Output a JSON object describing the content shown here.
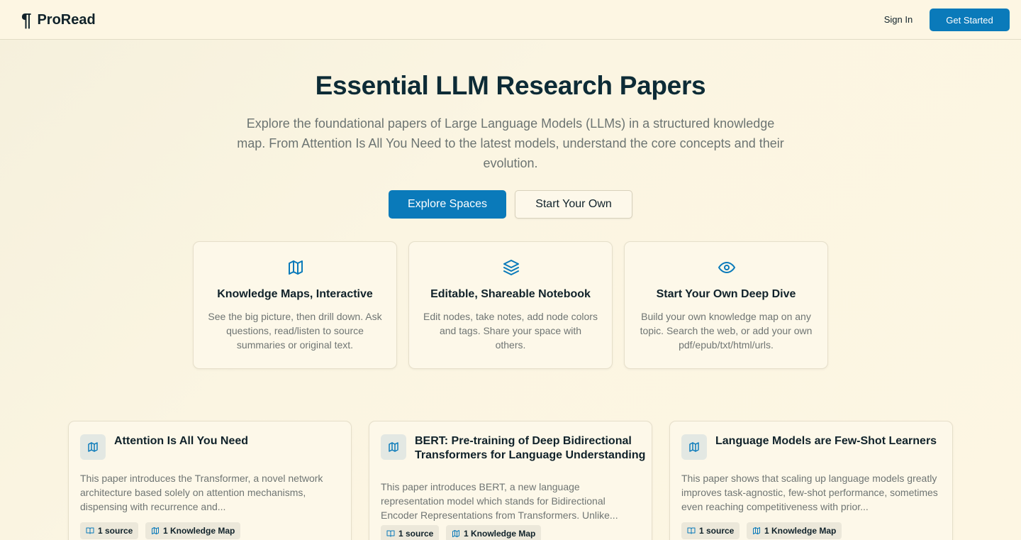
{
  "header": {
    "brand_mark": "¶",
    "brand_name": "ProRead",
    "signin_label": "Sign In",
    "getstarted_label": "Get Started"
  },
  "hero": {
    "title": "Essential LLM Research Papers",
    "subtitle": "Explore the foundational papers of Large Language Models (LLMs) in a structured knowledge map. From Attention Is All You Need to the latest models, understand the core concepts and their evolution.",
    "primary_label": "Explore Spaces",
    "secondary_label": "Start Your Own"
  },
  "features": [
    {
      "icon": "map-icon",
      "title": "Knowledge Maps, Interactive",
      "desc": "See the big picture, then drill down. Ask questions, read/listen to source summaries or original text."
    },
    {
      "icon": "layers-icon",
      "title": "Editable, Shareable Notebook",
      "desc": "Edit nodes, take notes, add node colors and tags. Share your space with others."
    },
    {
      "icon": "eye-icon",
      "title": "Start Your Own Deep Dive",
      "desc": "Build your own knowledge map on any topic. Search the web, or add your own pdf/epub/txt/html/urls."
    }
  ],
  "papers": [
    {
      "title": "Attention Is All You Need",
      "desc": "This paper introduces the Transformer, a novel network architecture based solely on attention mechanisms, dispensing with recurrence and...",
      "sources": "1 source",
      "maps": "1 Knowledge Map"
    },
    {
      "title": "BERT: Pre-training of Deep Bidirectional Transformers for Language Understanding",
      "desc": "This paper introduces BERT, a new language representation model which stands for Bidirectional Encoder Representations from Transformers. Unlike...",
      "sources": "1 source",
      "maps": "1 Knowledge Map"
    },
    {
      "title": "Language Models are Few-Shot Learners",
      "desc": "This paper shows that scaling up language models greatly improves task-agnostic, few-shot performance, sometimes even reaching competitiveness with prior...",
      "sources": "1 source",
      "maps": "1 Knowledge Map"
    }
  ],
  "colors": {
    "accent": "#0a7aba",
    "background": "#fdf6e3",
    "text": "#0f2a33"
  }
}
